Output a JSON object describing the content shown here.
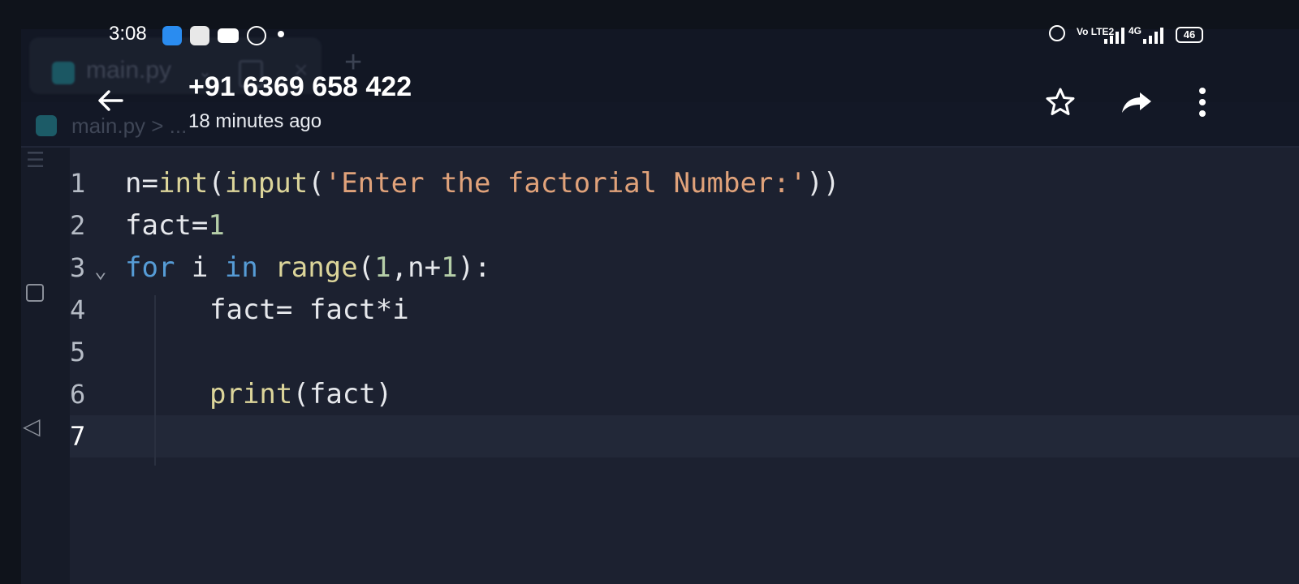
{
  "status_bar": {
    "time": "3:08",
    "battery": "46",
    "network": "4G",
    "volte": "Vo LTE2"
  },
  "header": {
    "title": "+91 6369 658 422",
    "subtitle": "18 minutes ago"
  },
  "editor": {
    "tab_name": "main.py",
    "breadcrumb": "main.py > ...",
    "lines": [
      {
        "number": "1",
        "code": "n=int(input('Enter the factorial Number:'))"
      },
      {
        "number": "2",
        "code": "fact=1"
      },
      {
        "number": "3",
        "code": "for i in range(1,n+1):"
      },
      {
        "number": "4",
        "code": "fact= fact*i"
      },
      {
        "number": "5",
        "code": ""
      },
      {
        "number": "6",
        "code": "print(fact)"
      },
      {
        "number": "7",
        "code": ""
      }
    ]
  },
  "icons": {
    "back": "arrow-left-icon",
    "star": "star-icon",
    "share": "share-icon",
    "more": "more-vertical-icon"
  }
}
